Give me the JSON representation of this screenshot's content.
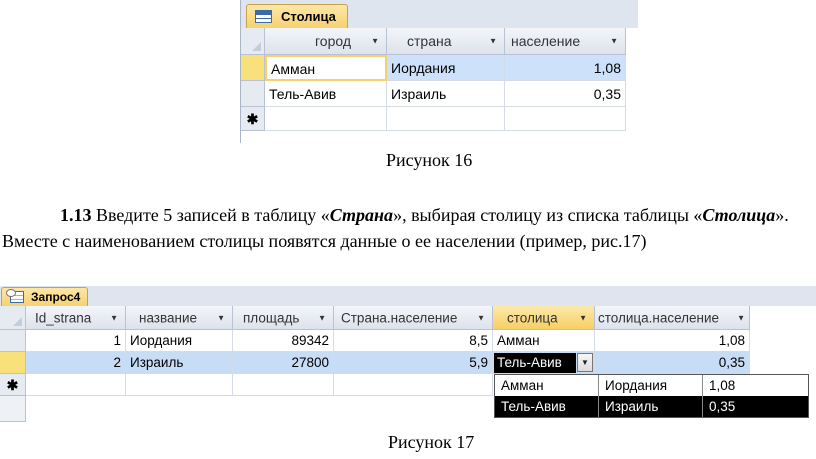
{
  "figure16": {
    "tab_title": "Столица",
    "columns": [
      "город",
      "страна",
      "население"
    ],
    "rows": [
      {
        "gorod": "Амман",
        "strana": "Иордания",
        "naselenie": "1,08"
      },
      {
        "gorod": "Тель-Авив",
        "strana": "Израиль",
        "naselenie": "0,35"
      }
    ],
    "new_row_marker": "✱",
    "caption": "Рисунок 16"
  },
  "instruction": {
    "number": "1.13",
    "text_1": " Введите 5 записей в таблицу «",
    "emph_1": "Страна",
    "text_2": "», выбирая столицу из списка таблицы «",
    "emph_2": "Столица",
    "text_3": "». Вместе с наименованием столицы появятся данные о ее населении (пример, рис.17)"
  },
  "figure17": {
    "tab_title": "Запрос4",
    "columns": [
      "Id_strana",
      "название",
      "площадь",
      "Страна.население",
      "столица",
      "столица.население"
    ],
    "rows": [
      {
        "id": "1",
        "name": "Иордания",
        "area": "89342",
        "pop": "8,5",
        "capital": "Амман",
        "cap_pop": "1,08"
      },
      {
        "id": "2",
        "name": "Израиль",
        "area": "27800",
        "pop": "5,9",
        "capital": "Тель-Авив",
        "cap_pop": "0,35"
      }
    ],
    "new_row_marker": "✱",
    "dropdown": [
      {
        "city": "Амман",
        "country": "Иордания",
        "pop": "1,08"
      },
      {
        "city": "Тель-Авив",
        "country": "Израиль",
        "pop": "0,35"
      }
    ],
    "caption": "Рисунок 17"
  },
  "colors": {
    "tab_active": "#f7d06e",
    "selected_row": "#c7dcf5",
    "current_cell": "#f8e07a",
    "field_highlight": "#cde2fa"
  },
  "icons": [
    "table-icon",
    "query-icon",
    "chevron-down-icon",
    "new-record-icon"
  ]
}
